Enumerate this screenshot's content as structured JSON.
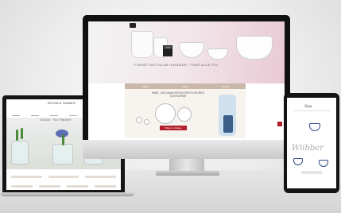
{
  "imac": {
    "hero_caption": "FORMET MOTIVLAR HANDEER / TOUR ALLIE FIN",
    "tag_text": "1000",
    "band_tabs": [
      "TOILE",
      "TOILE",
      "TOILE"
    ],
    "band_text": "MINE, JACOMAN EN EN PROTO BORED 'CONTURME'",
    "cta": "Shop tu Unique"
  },
  "laptop": {
    "logo": "ROYALE GAMES",
    "banner": "STUDIO · TILE FINDERY"
  },
  "tablet": {
    "logo": "Spa",
    "word": "Wiibber"
  },
  "colors": {
    "accent": "#b21f2d",
    "band": "#c9b8a8",
    "blue": "#2f4a8a"
  }
}
